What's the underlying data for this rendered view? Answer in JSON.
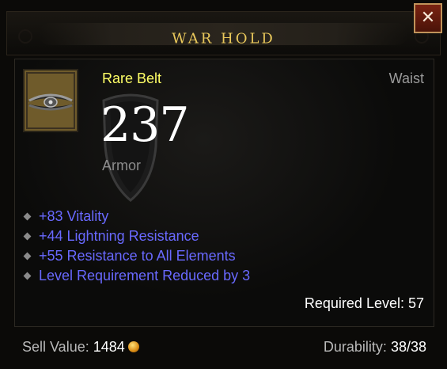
{
  "item": {
    "name": "WAR HOLD",
    "rarity_type": "Rare Belt",
    "slot": "Waist",
    "armor_value": "237",
    "armor_label": "Armor",
    "icon": "belt-icon",
    "affixes": [
      "+83 Vitality",
      "+44 Lightning Resistance",
      "+55 Resistance to All Elements",
      "Level Requirement Reduced by 3"
    ],
    "required_level": "Required Level: 57"
  },
  "footer": {
    "sell_label": "Sell Value:",
    "sell_value": "1484",
    "durability_label": "Durability:",
    "durability_value": "38/38"
  },
  "controls": {
    "close_label": "✕"
  },
  "colors": {
    "title": "#e9c85b",
    "rarity": "#ffff66",
    "affix": "#6969ff",
    "close_button": "#7a2312"
  }
}
